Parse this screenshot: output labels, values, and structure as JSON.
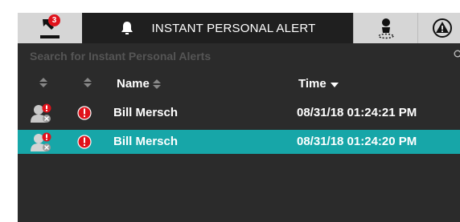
{
  "tabs": {
    "nav_badge": "3",
    "active_title": "INSTANT PERSONAL ALERT"
  },
  "search": {
    "placeholder": "Search for Instant Personal Alerts"
  },
  "table": {
    "headers": {
      "name": "Name",
      "time": "Time"
    },
    "rows": [
      {
        "name": "Bill Mersch",
        "time": "08/31/18 01:24:21 PM",
        "selected": false
      },
      {
        "name": "Bill Mersch",
        "time": "08/31/18 01:24:20 PM",
        "selected": true
      }
    ]
  },
  "colors": {
    "accent": "#17a6a8",
    "alert_red": "#e0121b",
    "panel_bg": "#2b2b2b"
  }
}
